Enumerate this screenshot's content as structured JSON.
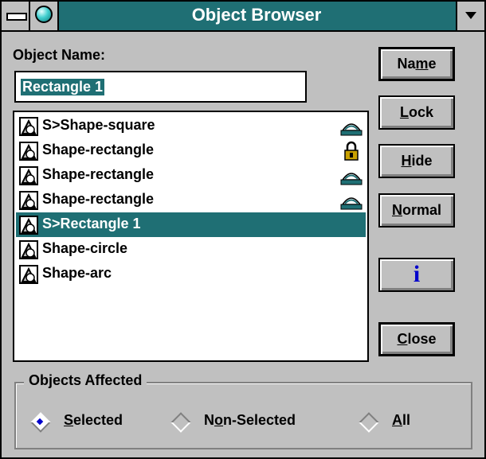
{
  "window": {
    "title": "Object Browser"
  },
  "object_name": {
    "label": "Object Name:",
    "value": "Rectangle 1"
  },
  "list": {
    "items": [
      {
        "text": "S>Shape-square",
        "state": "visible",
        "selected": false
      },
      {
        "text": "Shape-rectangle",
        "state": "locked",
        "selected": false
      },
      {
        "text": "Shape-rectangle",
        "state": "visible",
        "selected": false
      },
      {
        "text": "Shape-rectangle",
        "state": "visible",
        "selected": false
      },
      {
        "text": "S>Rectangle 1",
        "state": "none",
        "selected": true
      },
      {
        "text": "Shape-circle",
        "state": "none",
        "selected": false
      },
      {
        "text": "Shape-arc",
        "state": "none",
        "selected": false
      }
    ]
  },
  "buttons": {
    "name": {
      "pre": "Na",
      "ul": "m",
      "post": "e"
    },
    "lock": {
      "pre": "",
      "ul": "L",
      "post": "ock"
    },
    "hide": {
      "pre": "",
      "ul": "H",
      "post": "ide"
    },
    "normal": {
      "pre": "",
      "ul": "N",
      "post": "ormal"
    },
    "info": {
      "icon": "info-icon",
      "glyph": "i"
    },
    "close": {
      "pre": "",
      "ul": "C",
      "post": "lose"
    }
  },
  "objects_affected": {
    "label": "Objects Affected",
    "options": [
      {
        "pre": "",
        "ul": "S",
        "post": "elected",
        "checked": true
      },
      {
        "pre": "N",
        "ul": "o",
        "post": "n-Selected",
        "checked": false
      },
      {
        "pre": "",
        "ul": "A",
        "post": "ll",
        "checked": false
      }
    ]
  },
  "colors": {
    "title_bar": "#1f6f74",
    "selection": "#1f6f74",
    "face": "#c0c0c0",
    "info_glyph": "#0000cc"
  }
}
